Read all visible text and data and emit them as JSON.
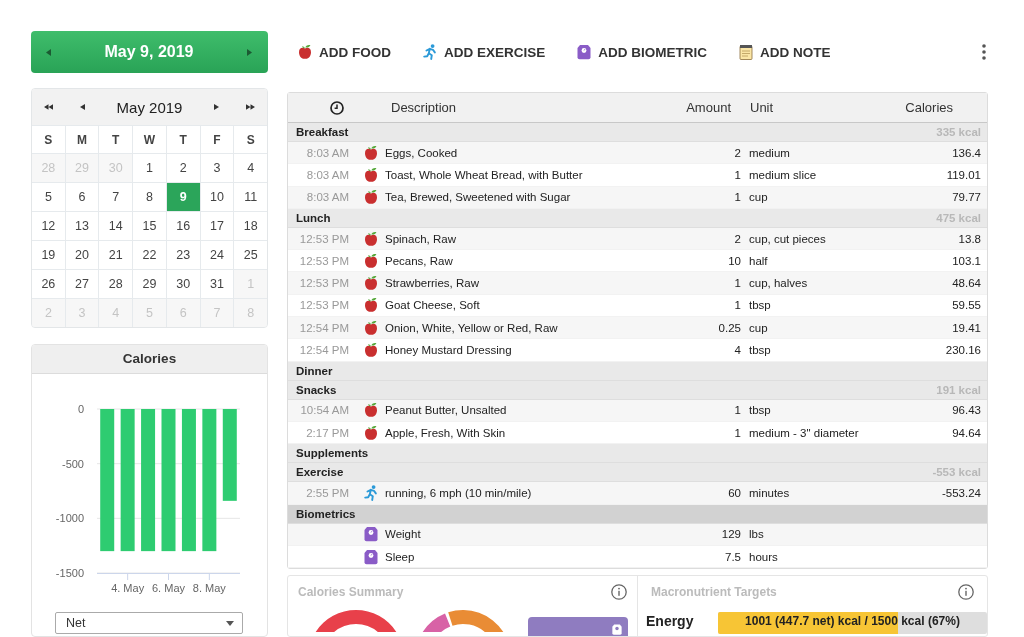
{
  "date_bar": {
    "date": "May 9, 2019"
  },
  "actions": [
    {
      "kind": "food",
      "label": "ADD FOOD"
    },
    {
      "kind": "exercise",
      "label": "ADD EXERCISE"
    },
    {
      "kind": "biometric",
      "label": "ADD BIOMETRIC"
    },
    {
      "kind": "note",
      "label": "ADD NOTE"
    }
  ],
  "calendar": {
    "title": "May 2019",
    "weekdays": [
      "S",
      "M",
      "T",
      "W",
      "T",
      "F",
      "S"
    ],
    "weeks": [
      [
        {
          "day": "28",
          "selected": false,
          "outside_month": true
        },
        {
          "day": "29",
          "selected": false,
          "outside_month": true
        },
        {
          "day": "30",
          "selected": false,
          "outside_month": true
        },
        {
          "day": "1",
          "selected": false,
          "outside_month": false
        },
        {
          "day": "2",
          "selected": false,
          "outside_month": false
        },
        {
          "day": "3",
          "selected": false,
          "outside_month": false
        },
        {
          "day": "4",
          "selected": false,
          "outside_month": false
        }
      ],
      [
        {
          "day": "5",
          "selected": false,
          "outside_month": false
        },
        {
          "day": "6",
          "selected": false,
          "outside_month": false
        },
        {
          "day": "7",
          "selected": false,
          "outside_month": false
        },
        {
          "day": "8",
          "selected": false,
          "outside_month": false
        },
        {
          "day": "9",
          "selected": true,
          "outside_month": false
        },
        {
          "day": "10",
          "selected": false,
          "outside_month": false
        },
        {
          "day": "11",
          "selected": false,
          "outside_month": false
        }
      ],
      [
        {
          "day": "12",
          "selected": false,
          "outside_month": false
        },
        {
          "day": "13",
          "selected": false,
          "outside_month": false
        },
        {
          "day": "14",
          "selected": false,
          "outside_month": false
        },
        {
          "day": "15",
          "selected": false,
          "outside_month": false
        },
        {
          "day": "16",
          "selected": false,
          "outside_month": false
        },
        {
          "day": "17",
          "selected": false,
          "outside_month": false
        },
        {
          "day": "18",
          "selected": false,
          "outside_month": false
        }
      ],
      [
        {
          "day": "19",
          "selected": false,
          "outside_month": false
        },
        {
          "day": "20",
          "selected": false,
          "outside_month": false
        },
        {
          "day": "21",
          "selected": false,
          "outside_month": false
        },
        {
          "day": "22",
          "selected": false,
          "outside_month": false
        },
        {
          "day": "23",
          "selected": false,
          "outside_month": false
        },
        {
          "day": "24",
          "selected": false,
          "outside_month": false
        },
        {
          "day": "25",
          "selected": false,
          "outside_month": false
        }
      ],
      [
        {
          "day": "26",
          "selected": false,
          "outside_month": false
        },
        {
          "day": "27",
          "selected": false,
          "outside_month": false
        },
        {
          "day": "28",
          "selected": false,
          "outside_month": false
        },
        {
          "day": "29",
          "selected": false,
          "outside_month": false
        },
        {
          "day": "30",
          "selected": false,
          "outside_month": false
        },
        {
          "day": "31",
          "selected": false,
          "outside_month": false
        },
        {
          "day": "1",
          "selected": false,
          "outside_month": true
        }
      ],
      [
        {
          "day": "2",
          "selected": false,
          "outside_month": true
        },
        {
          "day": "3",
          "selected": false,
          "outside_month": true
        },
        {
          "day": "4",
          "selected": false,
          "outside_month": true
        },
        {
          "day": "5",
          "selected": false,
          "outside_month": true
        },
        {
          "day": "6",
          "selected": false,
          "outside_month": true
        },
        {
          "day": "7",
          "selected": false,
          "outside_month": true
        },
        {
          "day": "8",
          "selected": false,
          "outside_month": true
        }
      ]
    ]
  },
  "calories_chart": {
    "chart_data": {
      "type": "bar",
      "title": "Calories",
      "categories": [
        null,
        "4. May",
        null,
        "6. May",
        null,
        "8. May",
        null
      ],
      "values": [
        -1300,
        -1300,
        -1300,
        -1300,
        -1300,
        -1300,
        -840
      ],
      "yticks": [
        0,
        -500,
        -1000,
        -1500
      ],
      "ylim": [
        -1500,
        0
      ]
    },
    "dropdown": {
      "value": "Net"
    }
  },
  "diary": {
    "columns": [
      "Description",
      "Amount",
      "Unit",
      "Calories"
    ],
    "sections": [
      {
        "name": "Breakfast",
        "total": "335 kcal",
        "selected": false,
        "entries": [
          {
            "kind": "food",
            "time": "8:03 AM",
            "description": "Eggs, Cooked",
            "amount": "2",
            "unit": "medium",
            "calories": "136.4"
          },
          {
            "kind": "food",
            "time": "8:03 AM",
            "description": "Toast, Whole Wheat Bread, with Butter",
            "amount": "1",
            "unit": "medium slice",
            "calories": "119.01"
          },
          {
            "kind": "food",
            "time": "8:03 AM",
            "description": "Tea, Brewed, Sweetened with Sugar",
            "amount": "1",
            "unit": "cup",
            "calories": "79.77"
          }
        ]
      },
      {
        "name": "Lunch",
        "total": "475 kcal",
        "selected": false,
        "entries": [
          {
            "kind": "food",
            "time": "12:53 PM",
            "description": "Spinach, Raw",
            "amount": "2",
            "unit": "cup, cut pieces",
            "calories": "13.8"
          },
          {
            "kind": "food",
            "time": "12:53 PM",
            "description": "Pecans, Raw",
            "amount": "10",
            "unit": "half",
            "calories": "103.1"
          },
          {
            "kind": "food",
            "time": "12:53 PM",
            "description": "Strawberries, Raw",
            "amount": "1",
            "unit": "cup, halves",
            "calories": "48.64"
          },
          {
            "kind": "food",
            "time": "12:53 PM",
            "description": "Goat Cheese, Soft",
            "amount": "1",
            "unit": "tbsp",
            "calories": "59.55"
          },
          {
            "kind": "food",
            "time": "12:54 PM",
            "description": "Onion, White, Yellow or Red, Raw",
            "amount": "0.25",
            "unit": "cup",
            "calories": "19.41"
          },
          {
            "kind": "food",
            "time": "12:54 PM",
            "description": "Honey Mustard Dressing",
            "amount": "4",
            "unit": "tbsp",
            "calories": "230.16"
          }
        ]
      },
      {
        "name": "Dinner",
        "selected": false
      },
      {
        "name": "Snacks",
        "total": "191 kcal",
        "selected": false,
        "entries": [
          {
            "kind": "food",
            "time": "10:54 AM",
            "description": "Peanut Butter, Unsalted",
            "amount": "1",
            "unit": "tbsp",
            "calories": "96.43"
          },
          {
            "kind": "food",
            "time": "2:17 PM",
            "description": "Apple, Fresh, With Skin",
            "amount": "1",
            "unit": "medium - 3\" diameter",
            "calories": "94.64"
          }
        ]
      },
      {
        "name": "Supplements",
        "selected": false
      },
      {
        "name": "Exercise",
        "total": "-553 kcal",
        "selected": false,
        "entries": [
          {
            "kind": "exercise",
            "time": "2:55 PM",
            "description": "running, 6 mph (10 min/mile)",
            "amount": "60",
            "unit": "minutes",
            "calories": "-553.24"
          }
        ]
      },
      {
        "name": "Biometrics",
        "selected": true,
        "entries": [
          {
            "kind": "biometric",
            "description": "Weight",
            "amount": "129",
            "unit": "lbs"
          },
          {
            "kind": "biometric",
            "description": "Sleep",
            "amount": "7.5",
            "unit": "hours"
          }
        ]
      }
    ]
  },
  "calories_summary": {
    "title": "Calories Summary"
  },
  "macronutrient_targets": {
    "title": "Macronutrient Targets",
    "rows": [
      {
        "name": "Energy",
        "level": 0.67,
        "reading": "1001 (447.7 net) kcal / 1500 kcal (67%)"
      }
    ]
  }
}
